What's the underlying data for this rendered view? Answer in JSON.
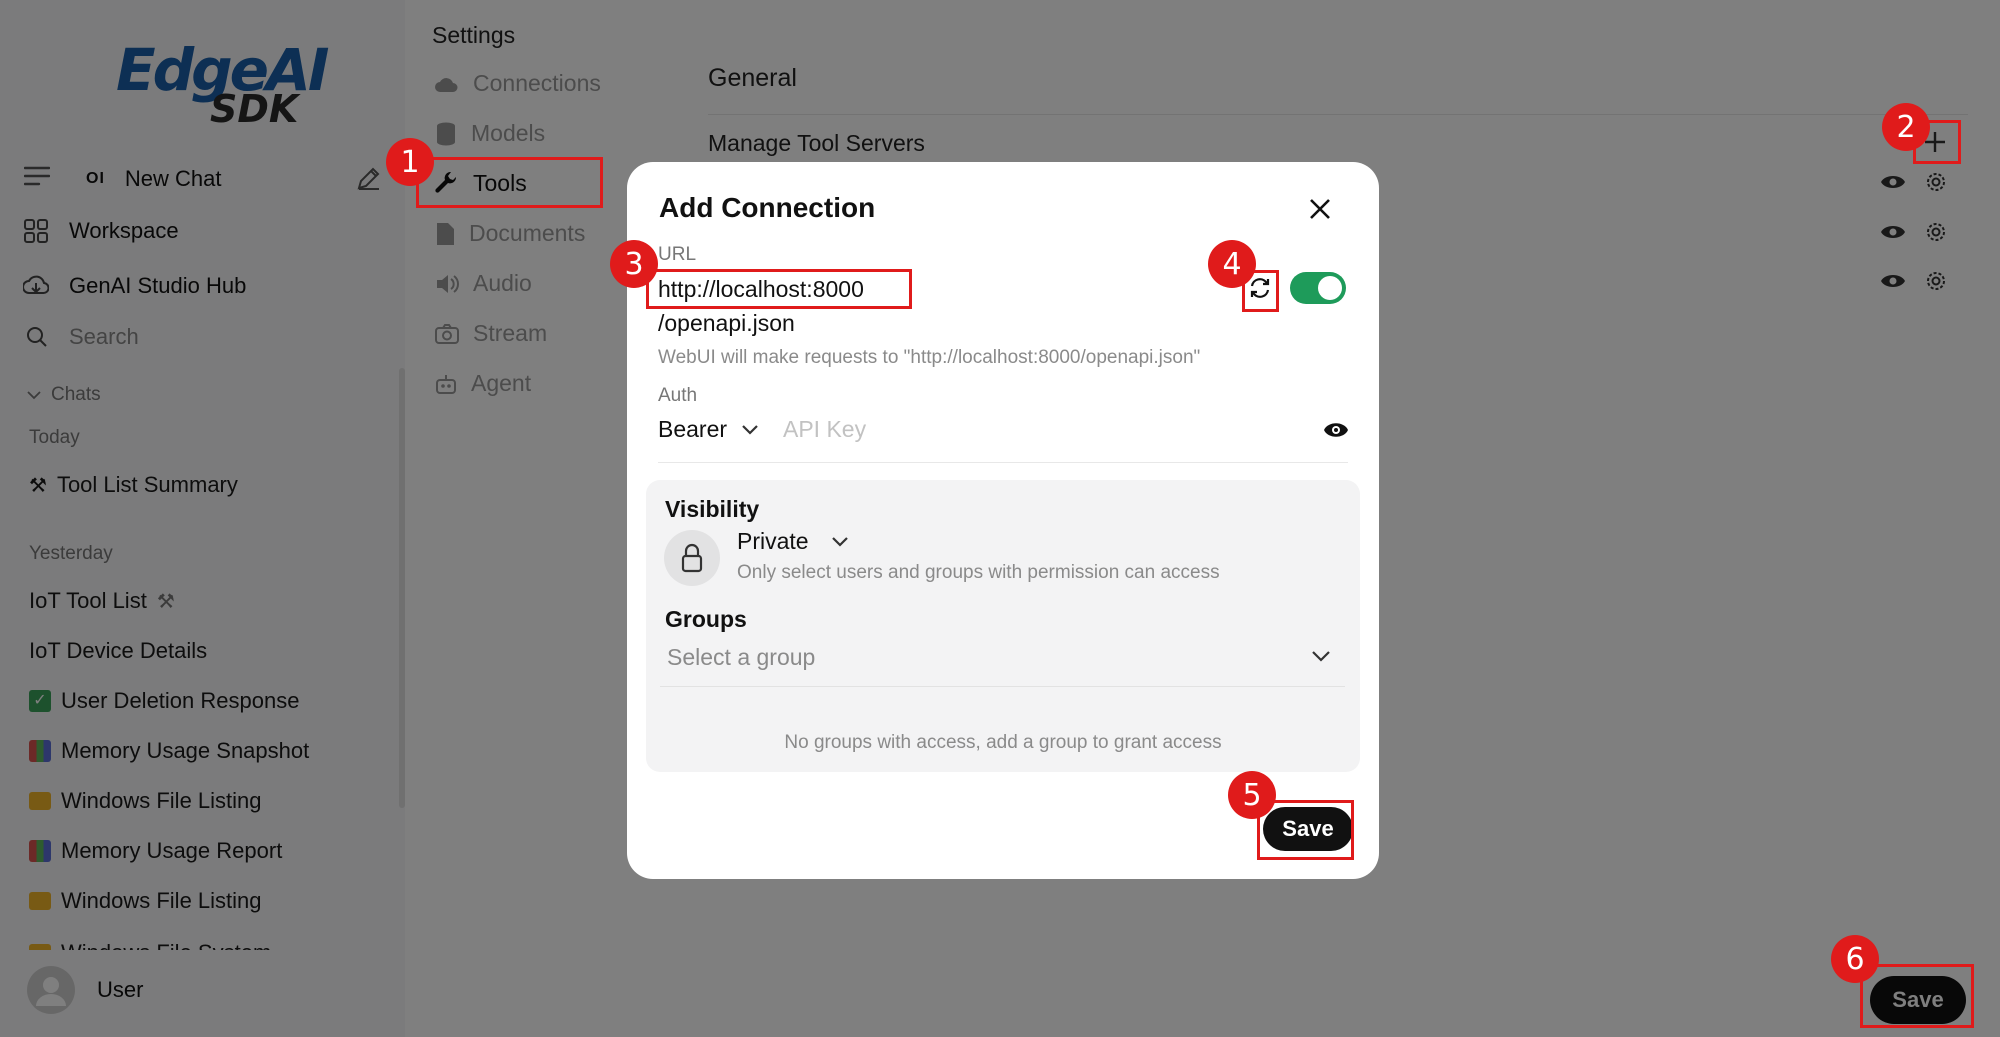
{
  "brand": {
    "name_top": "EdgeAI",
    "name_bottom": "SDK",
    "color": "#1a5ea8"
  },
  "sidebar": {
    "new_chat": "New Chat",
    "workspace": "Workspace",
    "hub": "GenAI Studio Hub",
    "search": "Search",
    "chats_header": "Chats",
    "today_header": "Today",
    "today_items": [
      {
        "label": "Tool List Summary",
        "icon": "hammer-wrench-icon"
      }
    ],
    "yesterday_header": "Yesterday",
    "yesterday_items": [
      {
        "label": "IoT Tool List",
        "icon": "hammer-wrench-icon"
      },
      {
        "label": "IoT Device Details",
        "icon": ""
      },
      {
        "label": "User Deletion Response",
        "icon": "check-box-icon"
      },
      {
        "label": "Memory Usage Snapshot",
        "icon": "bar-chart-icon"
      },
      {
        "label": "Windows File Listing",
        "icon": "folder-icon"
      },
      {
        "label": "Memory Usage Report",
        "icon": "bar-chart-icon"
      },
      {
        "label": "Windows File Listing",
        "icon": "folder-icon"
      },
      {
        "label": "Windows File System",
        "icon": "folder-icon"
      }
    ],
    "user": "User"
  },
  "settings": {
    "title": "Settings",
    "menu": [
      "Connections",
      "Models",
      "Tools",
      "Documents",
      "Audio",
      "Stream",
      "Agent"
    ],
    "section": "General",
    "manage_label": "Manage Tool Servers"
  },
  "modal": {
    "title": "Add Connection",
    "url_label": "URL",
    "url_value": "http://localhost:8000",
    "url_suffix": "/openapi.json",
    "hint": "WebUI will make requests to \"http://localhost:8000/openapi.json\"",
    "auth_label": "Auth",
    "auth_value": "Bearer",
    "api_key_placeholder": "API Key",
    "visibility_title": "Visibility",
    "visibility_value": "Private",
    "visibility_desc": "Only select users and groups with permission can access",
    "groups_title": "Groups",
    "groups_placeholder": "Select a group",
    "no_groups": "No groups with access, add a group to grant access",
    "save": "Save",
    "toggle_on": true
  },
  "page_save": "Save",
  "annotations": [
    "1",
    "2",
    "3",
    "4",
    "5",
    "6"
  ],
  "colors": {
    "accent_red": "#e01b1b",
    "toggle_green": "#1e9b5a",
    "overlay": "rgba(0,0,0,0.5)"
  }
}
